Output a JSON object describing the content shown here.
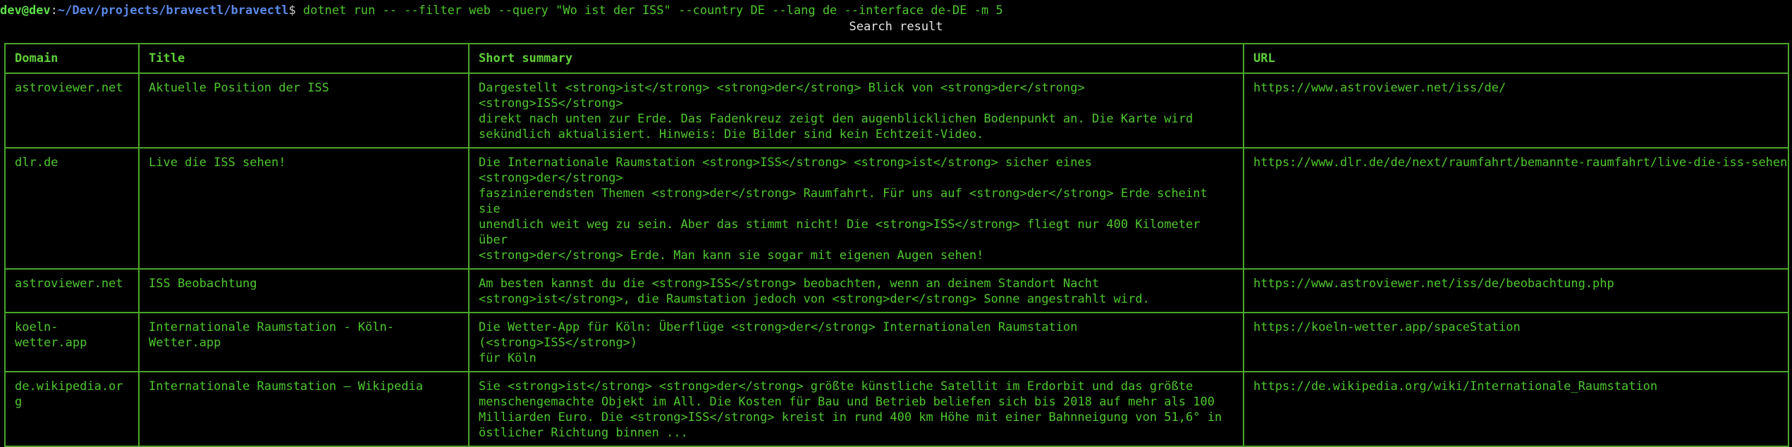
{
  "prompt": {
    "user_host": "dev@dev",
    "separator": ":",
    "path": "~/Dev/projects/bravectl/bravectl",
    "symbol": "$",
    "command": " dotnet run -- --filter web --query \"Wo ist der ISS\" --country DE --lang de --interface de-DE -m 5"
  },
  "caption": "Search result",
  "table": {
    "headers": [
      "Domain",
      "Title",
      "Short summary",
      "URL"
    ],
    "rows": [
      {
        "domain": "astroviewer.net",
        "title": "Aktuelle Position der ISS",
        "summary": "Dargestellt <strong>ist</strong> <strong>der</strong> Blick von <strong>der</strong> <strong>ISS</strong>\ndirekt nach unten zur Erde. Das Fadenkreuz zeigt den augenblicklichen Bodenpunkt an. Die Karte wird\nsekündlich aktualisiert. Hinweis: Die Bilder sind kein Echtzeit-Video.",
        "url": "https://www.astroviewer.net/iss/de/"
      },
      {
        "domain": "dlr.de",
        "title": "Live die ISS sehen!",
        "summary": "Die Internationale Raumstation <strong>ISS</strong> <strong>ist</strong> sicher eines <strong>der</strong>\nfaszinierendsten Themen <strong>der</strong> Raumfahrt. Für uns auf <strong>der</strong> Erde scheint sie\nunendlich weit weg zu sein. Aber das stimmt nicht! Die <strong>ISS</strong> fliegt nur 400 Kilometer über\n<strong>der</strong> Erde. Man kann sie sogar mit eigenen Augen sehen!",
        "url": "https://www.dlr.de/de/next/raumfahrt/bemannte-raumfahrt/live-die-iss-sehen"
      },
      {
        "domain": "astroviewer.net",
        "title": "ISS Beobachtung",
        "summary": "Am besten kannst du die <strong>ISS</strong> beobachten, wenn an deinem Standort Nacht\n<strong>ist</strong>, die Raumstation jedoch von <strong>der</strong> Sonne angestrahlt wird.",
        "url": "https://www.astroviewer.net/iss/de/beobachtung.php"
      },
      {
        "domain": "koeln-wetter.app",
        "title": "Internationale Raumstation - Köln-Wetter.app",
        "summary": "Die Wetter-App für Köln: Überflüge <strong>der</strong> Internationalen Raumstation (<strong>ISS</strong>)\nfür Köln",
        "url": "https://koeln-wetter.app/spaceStation"
      },
      {
        "domain": "de.wikipedia.org",
        "title": "Internationale Raumstation – Wikipedia",
        "summary": "Sie <strong>ist</strong> <strong>der</strong> größte künstliche Satellit im Erdorbit und das größte\nmenschengemachte Objekt im All. Die Kosten für Bau und Betrieb beliefen sich bis 2018 auf mehr als 100\nMilliarden Euro. Die <strong>ISS</strong> kreist in rund 400 km Höhe mit einer Bahnneigung von 51,6° in\nöstlicher Richtung binnen ...",
        "url": "https://de.wikipedia.org/wiki/Internationale_Raumstation"
      }
    ]
  }
}
